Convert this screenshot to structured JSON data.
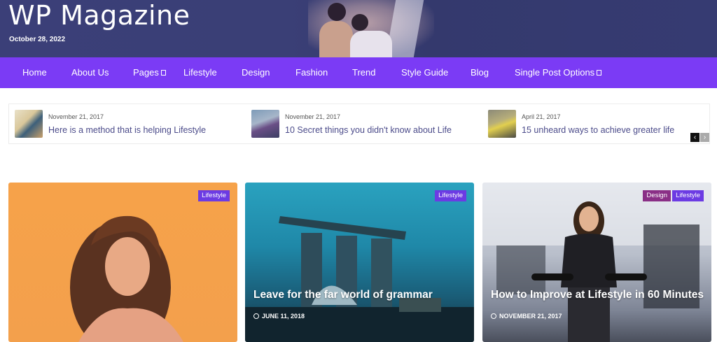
{
  "header": {
    "site_title": "WP Magazine",
    "date": "October 28, 2022"
  },
  "nav": {
    "items": [
      {
        "label": "Home"
      },
      {
        "label": "About Us"
      },
      {
        "label": "Pages"
      },
      {
        "label": "Lifestyle"
      },
      {
        "label": "Design"
      },
      {
        "label": "Fashion"
      },
      {
        "label": "Trend"
      },
      {
        "label": "Style Guide"
      },
      {
        "label": "Blog"
      },
      {
        "label": "Single  Post Options"
      }
    ]
  },
  "ticker": {
    "items": [
      {
        "date": "November 21, 2017",
        "title": "Here is a method that is helping  Lifestyle"
      },
      {
        "date": "November 21, 2017",
        "title": "10 Secret things you didn't know about  Life"
      },
      {
        "date": "April 21, 2017",
        "title": "15 unheard ways to achieve greater life"
      }
    ],
    "prev_icon": "chevron-left-icon",
    "next_icon": "chevron-right-icon"
  },
  "cards": [
    {
      "badges": [
        "Lifestyle"
      ],
      "title": "",
      "date": ""
    },
    {
      "badges": [
        "Lifestyle"
      ],
      "title": "Leave for the far world of grammar",
      "date": "JUNE 11, 2018"
    },
    {
      "badges": [
        "Design",
        "Lifestyle"
      ],
      "title": "How to  Improve at  Lifestyle in 60  Minutes",
      "date": "NOVEMBER 21, 2017"
    }
  ],
  "colors": {
    "nav": "#7b3bf5",
    "header": "#3b3f78",
    "badge": "#6c3be3",
    "badge_design": "#8a2f86"
  }
}
